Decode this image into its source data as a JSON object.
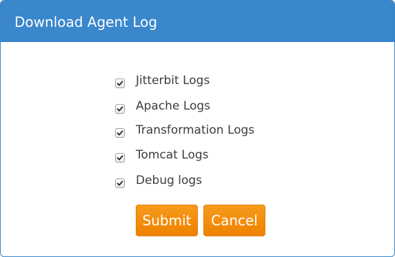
{
  "dialog": {
    "title": "Download Agent Log"
  },
  "options": [
    {
      "label": "Jitterbit Logs",
      "checked": true
    },
    {
      "label": "Apache Logs",
      "checked": true
    },
    {
      "label": "Transformation Logs",
      "checked": true
    },
    {
      "label": "Tomcat Logs",
      "checked": true
    },
    {
      "label": "Debug logs",
      "checked": true
    }
  ],
  "buttons": {
    "submit_label": "Submit",
    "cancel_label": "Cancel"
  },
  "colors": {
    "title_bar": "#3a87cc",
    "button": "#f28c0c",
    "text": "#3c3c3c"
  }
}
